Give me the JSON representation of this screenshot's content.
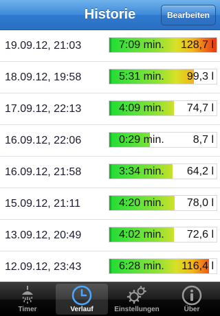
{
  "navbar": {
    "title": "Historie",
    "edit_label": "Bearbeiten"
  },
  "list": {
    "rows": [
      {
        "date": "19.09.12, 21:03",
        "time": "7:09 min.",
        "volume": "128,7 l",
        "fill_fraction": 1.0
      },
      {
        "date": "18.09.12, 19:58",
        "time": "5:31 min.",
        "volume": "99,3 l",
        "fill_fraction": 0.79
      },
      {
        "date": "17.09.12, 22:13",
        "time": "4:09 min.",
        "volume": "74,7 l",
        "fill_fraction": 0.6
      },
      {
        "date": "16.09.12, 22:06",
        "time": "0:29 min.",
        "volume": "8,7 l",
        "fill_fraction": 0.38
      },
      {
        "date": "16.09.12, 21:58",
        "time": "3:34 min.",
        "volume": "64,2 l",
        "fill_fraction": 0.59
      },
      {
        "date": "15.09.12, 21:11",
        "time": "4:20 min.",
        "volume": "78,0 l",
        "fill_fraction": 0.61
      },
      {
        "date": "13.09.12, 20:49",
        "time": "4:02 min.",
        "volume": "72,6 l",
        "fill_fraction": 0.6
      },
      {
        "date": "12.09.12, 23:43",
        "time": "6:28 min.",
        "volume": "116,4 l",
        "fill_fraction": 0.93
      }
    ],
    "partial_row_fill_fraction": 0.95
  },
  "tabbar": {
    "tabs": [
      {
        "label": "Timer",
        "icon": "shower-icon",
        "active": false
      },
      {
        "label": "Verlauf",
        "icon": "clock-icon",
        "active": true
      },
      {
        "label": "Einstellungen",
        "icon": "gears-icon",
        "active": false
      },
      {
        "label": "Über",
        "icon": "info-icon",
        "active": false
      }
    ]
  },
  "colors": {
    "nav_blue": "#3e8ad9",
    "bar_green": "#1fdc33",
    "bar_red": "#e63a14"
  }
}
